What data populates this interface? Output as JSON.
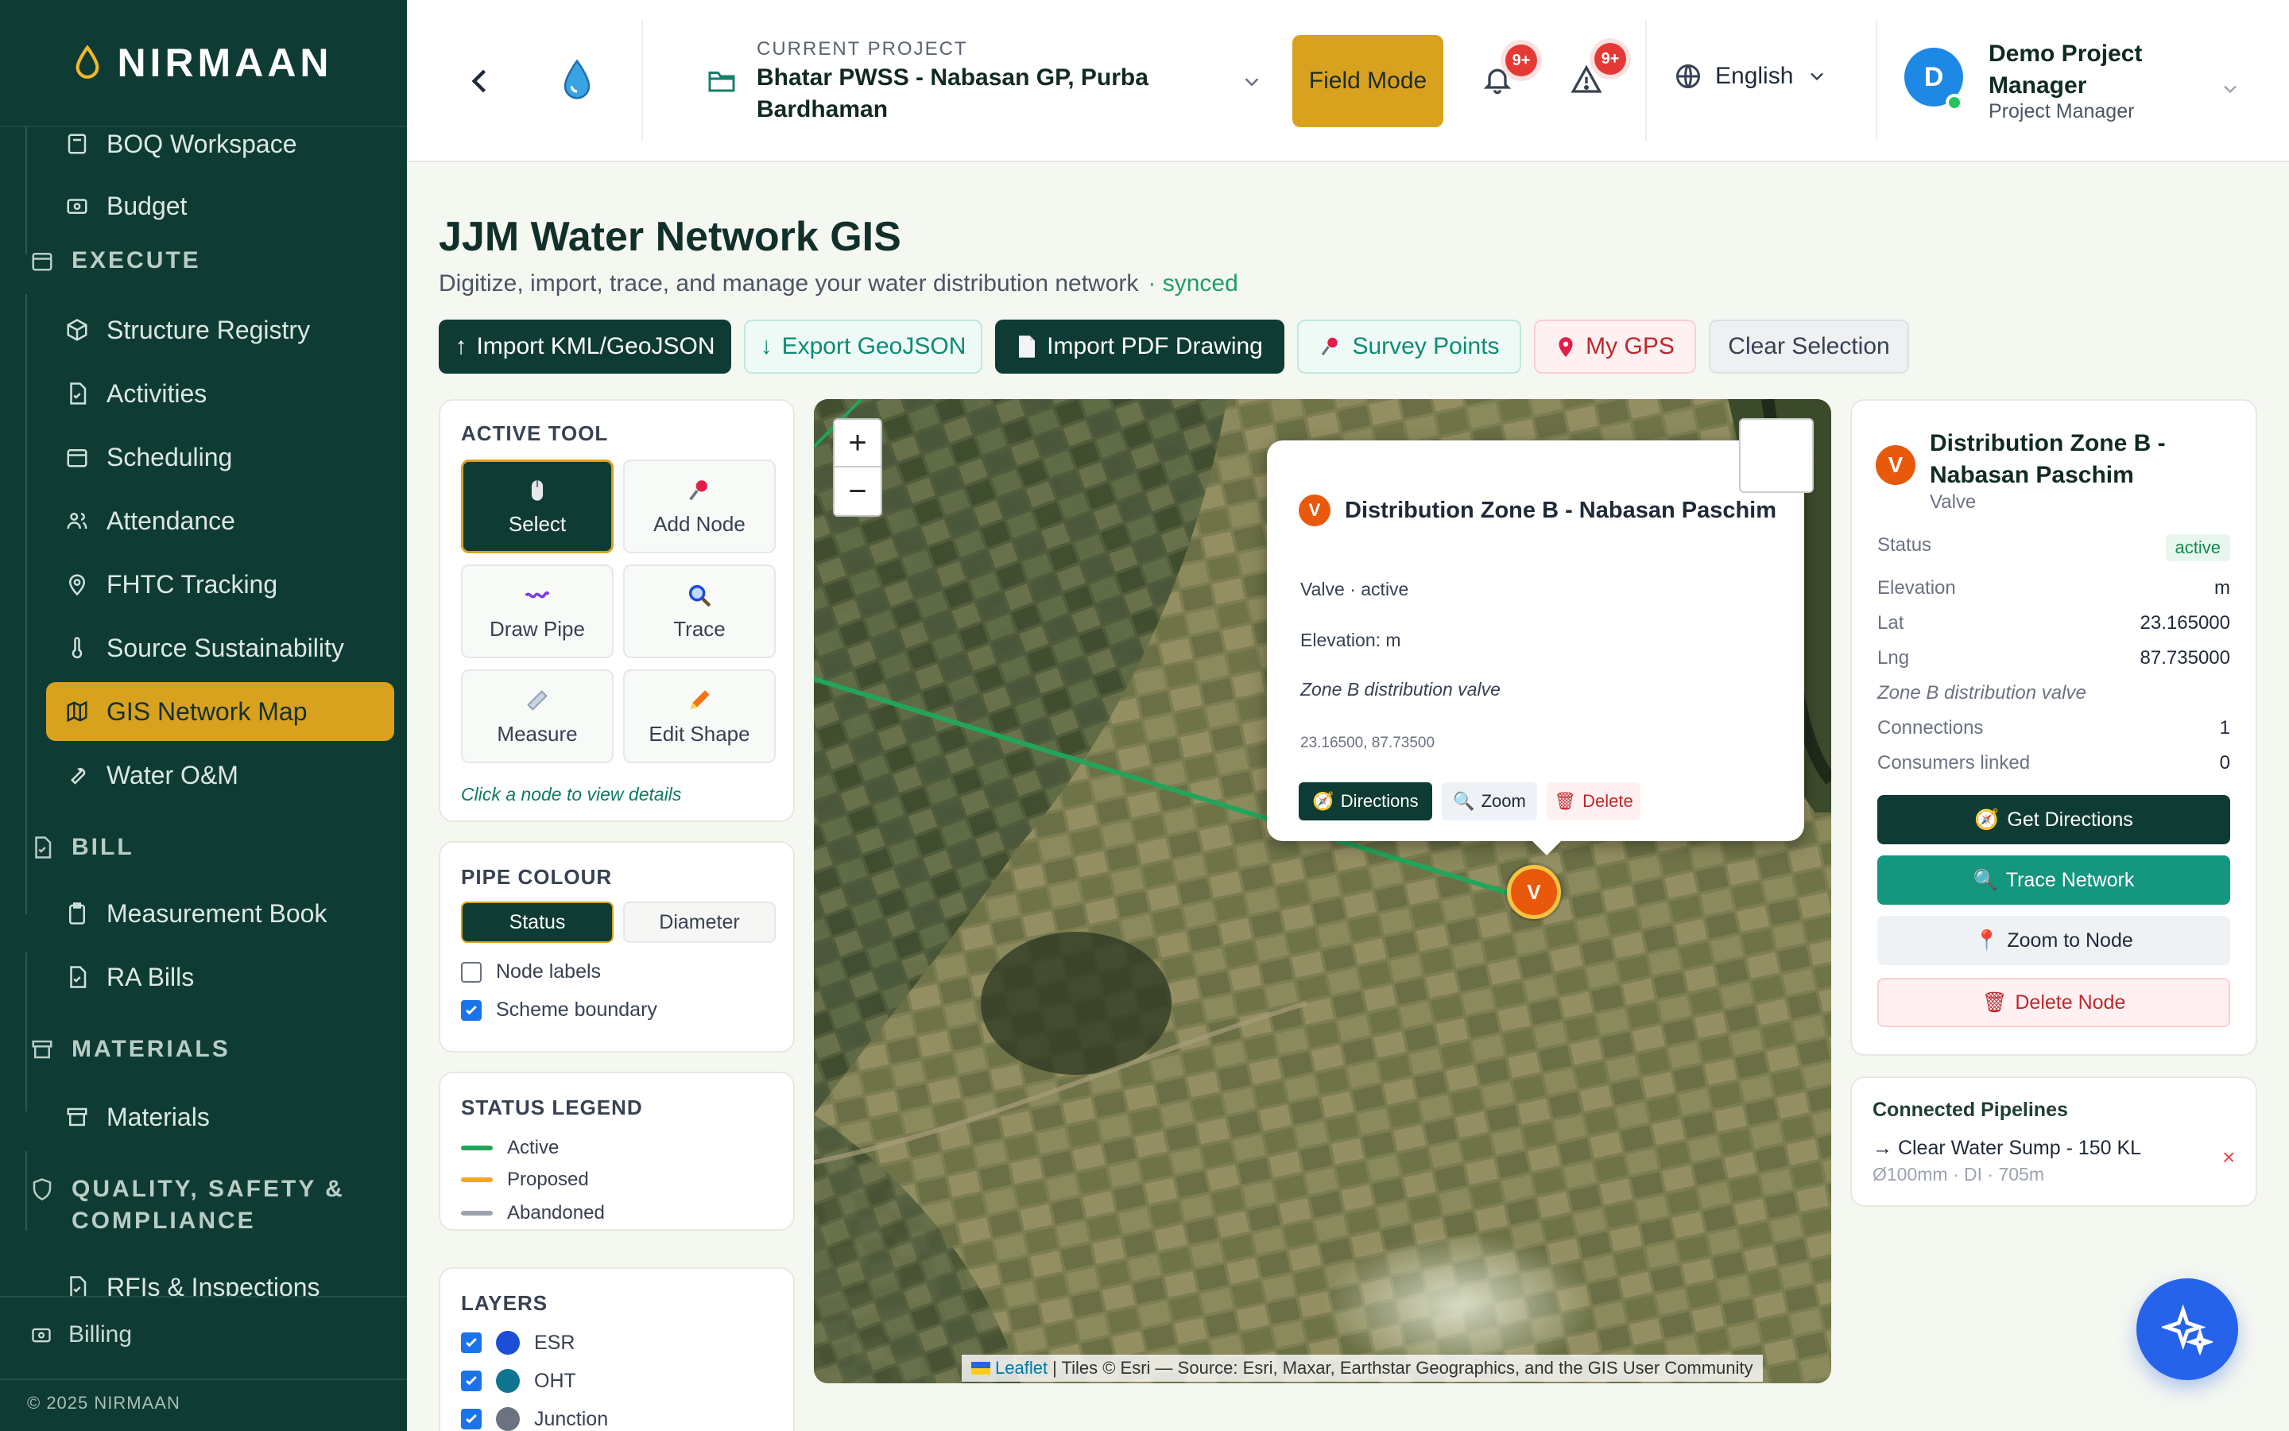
{
  "app": {
    "brand": "NIRMAAN",
    "copyright": "© 2025 NIRMAAN"
  },
  "sidebar": {
    "items": [
      {
        "label": "BOQ Workspace",
        "icon": "calculator-icon"
      },
      {
        "label": "Budget",
        "icon": "wallet-icon"
      },
      {
        "label": "Structure Registry",
        "icon": "cube-icon"
      },
      {
        "label": "Activities",
        "icon": "file-check-icon"
      },
      {
        "label": "Scheduling",
        "icon": "calendar-icon"
      },
      {
        "label": "Attendance",
        "icon": "people-icon"
      },
      {
        "label": "FHTC Tracking",
        "icon": "pin-icon"
      },
      {
        "label": "Source Sustainability",
        "icon": "thermometer-icon"
      },
      {
        "label": "GIS Network Map",
        "icon": "map-icon"
      },
      {
        "label": "Water O&M",
        "icon": "wrench-icon"
      },
      {
        "label": "Measurement Book",
        "icon": "clipboard-icon"
      },
      {
        "label": "RA Bills",
        "icon": "file-check-icon"
      },
      {
        "label": "Materials",
        "icon": "box-icon"
      },
      {
        "label": "RFIs & Inspections",
        "icon": "file-check-icon"
      }
    ],
    "sections": {
      "execute": "EXECUTE",
      "bill": "BILL",
      "materials": "MATERIALS",
      "quality": "QUALITY, SAFETY & COMPLIANCE"
    },
    "billing": "Billing"
  },
  "header": {
    "project_label": "CURRENT PROJECT",
    "project_name": "Bhatar PWSS - Nabasan GP, Purba Bardhaman",
    "field_mode": "Field Mode",
    "notif_badge": "9+",
    "alert_badge": "9+",
    "language": "English",
    "user_initial": "D",
    "user_name": "Demo Project Manager",
    "user_role": "Project Manager"
  },
  "page": {
    "title": "JJM Water Network GIS",
    "subtitle": "Digitize, import, trace, and manage your water distribution network",
    "synced": "· synced"
  },
  "toolbar": {
    "import_kml": "Import KML/GeoJSON",
    "export_geojson": "Export GeoJSON",
    "import_pdf": "Import PDF Drawing",
    "survey_points": "Survey Points",
    "my_gps": "My GPS",
    "clear_selection": "Clear Selection"
  },
  "tools": {
    "heading": "ACTIVE TOOL",
    "select": "Select",
    "add_node": "Add Node",
    "draw_pipe": "Draw Pipe",
    "trace": "Trace",
    "measure": "Measure",
    "edit_shape": "Edit Shape",
    "hint": "Click a node to view details"
  },
  "pipe_colour": {
    "heading": "PIPE COLOUR",
    "status": "Status",
    "diameter": "Diameter",
    "node_labels": "Node labels",
    "scheme_boundary": "Scheme boundary"
  },
  "status_legend": {
    "heading": "STATUS LEGEND",
    "items": [
      {
        "label": "Active",
        "color": "#22a55a"
      },
      {
        "label": "Proposed",
        "color": "#f5a524"
      },
      {
        "label": "Abandoned",
        "color": "#9ca3af"
      }
    ]
  },
  "layers": {
    "heading": "LAYERS",
    "items": [
      {
        "label": "ESR",
        "color": "#1d4ed8"
      },
      {
        "label": "OHT",
        "color": "#0e7490"
      },
      {
        "label": "Junction",
        "color": "#6b7280"
      }
    ]
  },
  "map": {
    "zoom_in": "+",
    "zoom_out": "−",
    "attribution_leaflet": "Leaflet",
    "attribution_rest": "| Tiles © Esri — Source: Esri, Maxar, Earthstar Geographics, and the GIS User Community",
    "marker_label": "V",
    "popup": {
      "title": "Distribution Zone B - Nabasan Paschim",
      "type_status": "Valve · active",
      "elevation": "Elevation: m",
      "note": "Zone B distribution valve",
      "coords": "23.16500, 87.73500",
      "directions": "Directions",
      "zoom": "Zoom",
      "delete": "Delete"
    }
  },
  "detail": {
    "badge": "V",
    "title": "Distribution Zone B - Nabasan Paschim",
    "type": "Valve",
    "status_label": "Status",
    "status_value": "active",
    "elevation_label": "Elevation",
    "elevation_value": "m",
    "lat_label": "Lat",
    "lat_value": "23.165000",
    "lng_label": "Lng",
    "lng_value": "87.735000",
    "note": "Zone B distribution valve",
    "connections_label": "Connections",
    "connections_value": "1",
    "consumers_label": "Consumers linked",
    "consumers_value": "0",
    "get_directions": "Get Directions",
    "trace_network": "Trace Network",
    "zoom_to_node": "Zoom to Node",
    "delete_node": "Delete Node"
  },
  "connected": {
    "heading": "Connected Pipelines",
    "name": "→ Clear Water Sump - 150 KL",
    "meta": "Ø100mm · DI · 705m",
    "remove": "×"
  }
}
